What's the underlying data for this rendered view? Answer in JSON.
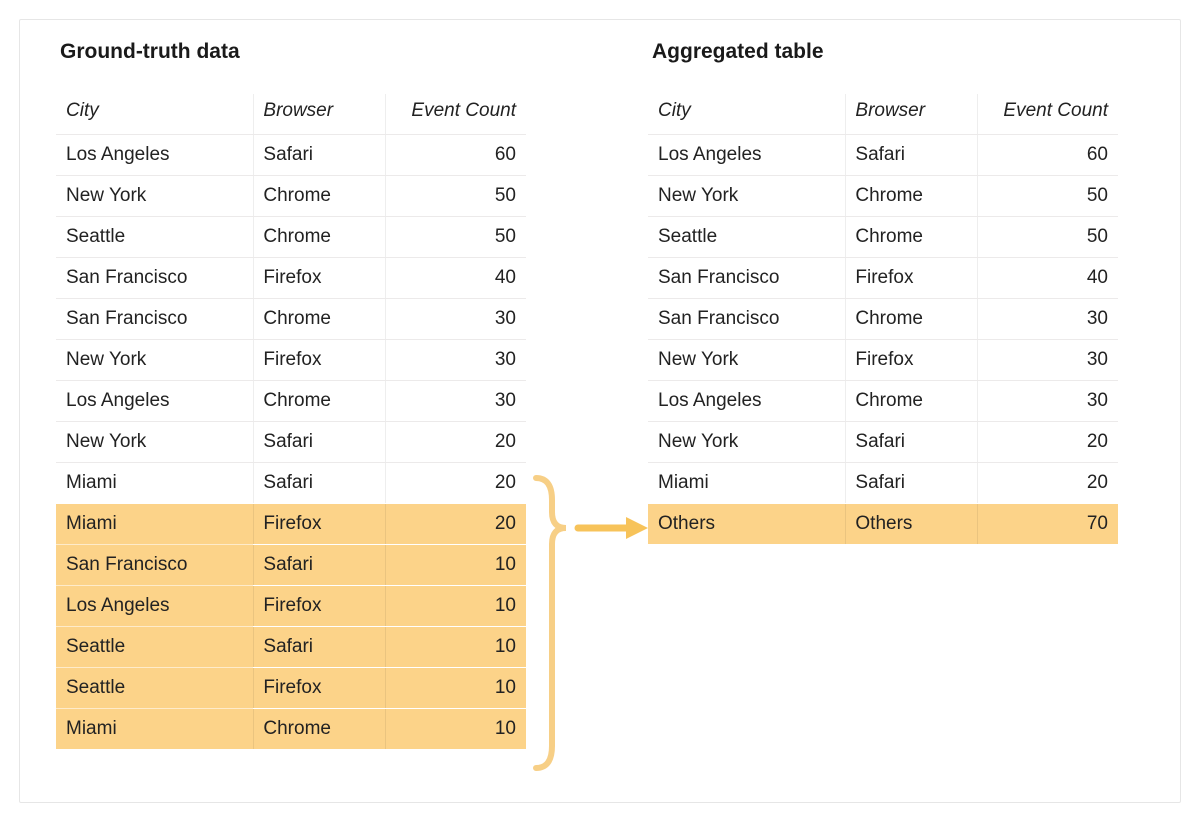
{
  "left": {
    "title": "Ground-truth data",
    "headers": {
      "city": "City",
      "browser": "Browser",
      "count": "Event Count"
    },
    "rows": [
      {
        "city": "Los Angeles",
        "browser": "Safari",
        "count": 60,
        "hl": false
      },
      {
        "city": "New York",
        "browser": "Chrome",
        "count": 50,
        "hl": false
      },
      {
        "city": "Seattle",
        "browser": "Chrome",
        "count": 50,
        "hl": false
      },
      {
        "city": "San Francisco",
        "browser": "Firefox",
        "count": 40,
        "hl": false
      },
      {
        "city": "San Francisco",
        "browser": "Chrome",
        "count": 30,
        "hl": false
      },
      {
        "city": "New York",
        "browser": "Firefox",
        "count": 30,
        "hl": false
      },
      {
        "city": "Los Angeles",
        "browser": "Chrome",
        "count": 30,
        "hl": false
      },
      {
        "city": "New York",
        "browser": "Safari",
        "count": 20,
        "hl": false
      },
      {
        "city": "Miami",
        "browser": "Safari",
        "count": 20,
        "hl": false
      },
      {
        "city": "Miami",
        "browser": "Firefox",
        "count": 20,
        "hl": true
      },
      {
        "city": "San Francisco",
        "browser": "Safari",
        "count": 10,
        "hl": true
      },
      {
        "city": "Los Angeles",
        "browser": "Firefox",
        "count": 10,
        "hl": true
      },
      {
        "city": "Seattle",
        "browser": "Safari",
        "count": 10,
        "hl": true
      },
      {
        "city": "Seattle",
        "browser": "Firefox",
        "count": 10,
        "hl": true
      },
      {
        "city": "Miami",
        "browser": "Chrome",
        "count": 10,
        "hl": true
      }
    ]
  },
  "right": {
    "title": "Aggregated table",
    "headers": {
      "city": "City",
      "browser": "Browser",
      "count": "Event Count"
    },
    "rows": [
      {
        "city": "Los Angeles",
        "browser": "Safari",
        "count": 60,
        "hl": false
      },
      {
        "city": "New York",
        "browser": "Chrome",
        "count": 50,
        "hl": false
      },
      {
        "city": "Seattle",
        "browser": "Chrome",
        "count": 50,
        "hl": false
      },
      {
        "city": "San Francisco",
        "browser": "Firefox",
        "count": 40,
        "hl": false
      },
      {
        "city": "San Francisco",
        "browser": "Chrome",
        "count": 30,
        "hl": false
      },
      {
        "city": "New York",
        "browser": "Firefox",
        "count": 30,
        "hl": false
      },
      {
        "city": "Los Angeles",
        "browser": "Chrome",
        "count": 30,
        "hl": false
      },
      {
        "city": "New York",
        "browser": "Safari",
        "count": 20,
        "hl": false
      },
      {
        "city": "Miami",
        "browser": "Safari",
        "count": 20,
        "hl": false
      },
      {
        "city": "Others",
        "browser": "Others",
        "count": 70,
        "hl": true
      }
    ]
  },
  "colors": {
    "highlight": "#fcd389",
    "arrow": "#f7c35a"
  }
}
